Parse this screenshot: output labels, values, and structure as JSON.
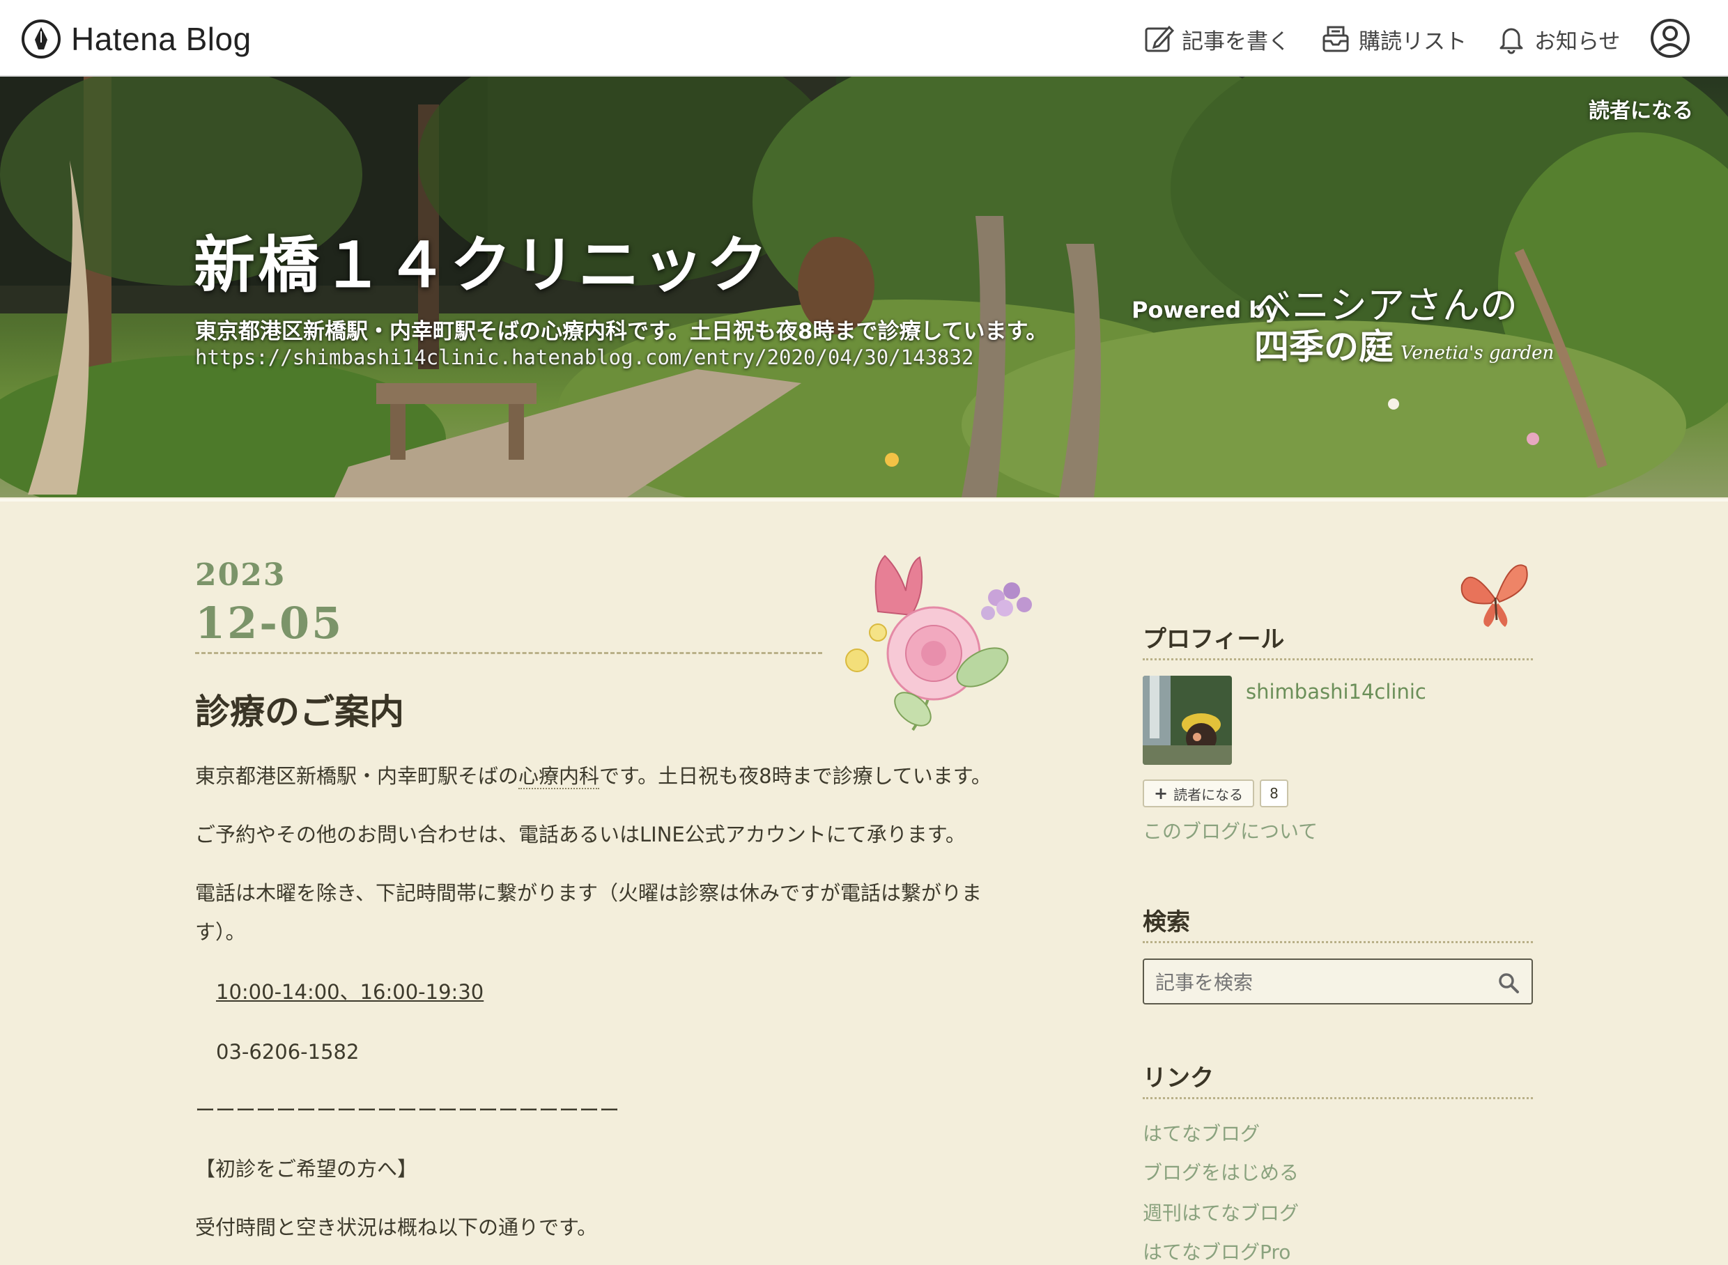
{
  "topbar": {
    "logo_text": "Hatena Blog",
    "nav": [
      {
        "label": "記事を書く",
        "icon": "edit-icon"
      },
      {
        "label": "購読リスト",
        "icon": "subscribe-list-icon"
      },
      {
        "label": "お知らせ",
        "icon": "bell-icon"
      }
    ],
    "user_icon": "user-icon"
  },
  "header": {
    "reader_link": "読者になる",
    "title": "新橋１４クリニック",
    "description": "東京都港区新橋駅・内幸町駅そばの心療内科です。土日祝も夜8時まで診療しています。",
    "url": "https://shimbashi14clinic.hatenablog.com/entry/2020/04/30/143832",
    "powered_by": "Powered by",
    "powered_line1": "ベニシアさんの",
    "powered_line2": "四季の庭",
    "powered_script": "Venetia's garden"
  },
  "entry": {
    "year": "2023",
    "month_day": "12-05",
    "title": "診療のご案内",
    "p1_before": "東京都港区新橋駅・内幸町駅そばの",
    "p1_keyword": "心療内科",
    "p1_after": "です。土日祝も夜8時まで診療しています。",
    "p2": "ご予約やその他のお問い合わせは、電話あるいはLINE公式アカウントにて承ります。",
    "p3_line1": "電話は木曜を除き、下記時間帯に繋がります（火曜は診察は休みですが電話は繋がりま",
    "p3_line2": "す）。",
    "hours": "10:00-14:00、16:00-19:30",
    "phone": "03-6206-1582",
    "divider": "ーーーーーーーーーーーーーーーーーーーーー",
    "first_visit": "【初診をご希望の方へ】",
    "reception": "受付時間と空き状況は概ね以下の通りです。"
  },
  "sidebar": {
    "profile_heading": "プロフィール",
    "username": "shimbashi14clinic",
    "subscribe_label": "読者になる",
    "subscriber_count": "8",
    "about_link": "このブログについて",
    "search_heading": "検索",
    "search_placeholder": "記事を検索",
    "links_heading": "リンク",
    "links": [
      "はてなブログ",
      "ブログをはじめる",
      "週刊はてなブログ",
      "はてなブログPro"
    ]
  },
  "colors": {
    "page_bg": "#f3eedb",
    "accent_green": "#7b9469",
    "link_green": "#8aa27e"
  }
}
